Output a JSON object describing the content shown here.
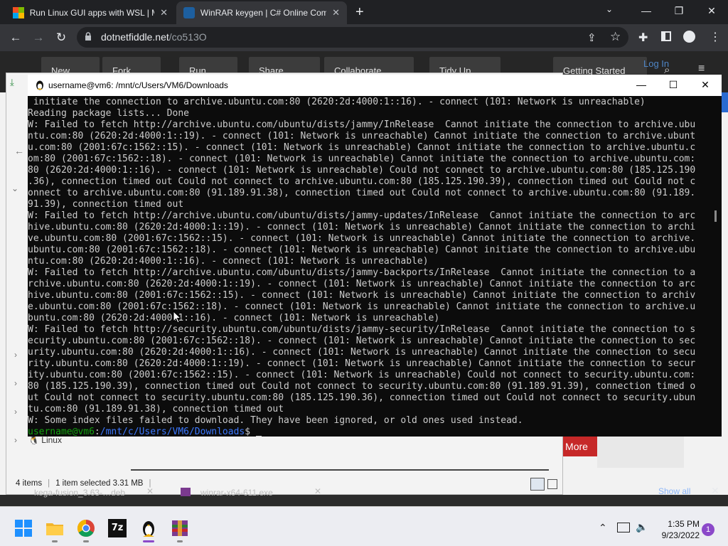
{
  "browser": {
    "tabs": [
      {
        "title": "Run Linux GUI apps with WSL | M",
        "active": false
      },
      {
        "title": "WinRAR keygen | C# Online Com",
        "active": true
      }
    ],
    "new_tab": "+",
    "window_controls": {
      "minimize": "—",
      "restore": "❐",
      "close": "✕"
    },
    "url_host": "dotnetfiddle.net",
    "url_path": "/co513O"
  },
  "site_toolbar": {
    "buttons": [
      "New",
      "Fork",
      "Run",
      "Share",
      "Collaborate",
      "Tidy Up",
      "Getting Started",
      "Log In"
    ]
  },
  "page": {
    "more_button": "More"
  },
  "explorer": {
    "sidebar_item": "Linux",
    "status_items": "4 items",
    "status_selected": "1 item selected  3.31 MB"
  },
  "downloads": {
    "items": [
      "kega-fusion_3.63-…deb",
      "winrar-x64-611.exe"
    ],
    "show_all": "Show all"
  },
  "terminal": {
    "title": "username@vm6: /mnt/c/Users/VM6/Downloads",
    "lines": [
      " initiate the connection to archive.ubuntu.com:80 (2620:2d:4000:1::16). - connect (101: Network is unreachable)",
      "Reading package lists... Done",
      "W: Failed to fetch http://archive.ubuntu.com/ubuntu/dists/jammy/InRelease  Cannot initiate the connection to archive.ubu",
      "ntu.com:80 (2620:2d:4000:1::19). - connect (101: Network is unreachable) Cannot initiate the connection to archive.ubunt",
      "u.com:80 (2001:67c:1562::15). - connect (101: Network is unreachable) Cannot initiate the connection to archive.ubuntu.c",
      "om:80 (2001:67c:1562::18). - connect (101: Network is unreachable) Cannot initiate the connection to archive.ubuntu.com:",
      "80 (2620:2d:4000:1::16). - connect (101: Network is unreachable) Could not connect to archive.ubuntu.com:80 (185.125.190",
      ".36), connection timed out Could not connect to archive.ubuntu.com:80 (185.125.190.39), connection timed out Could not c",
      "onnect to archive.ubuntu.com:80 (91.189.91.38), connection timed out Could not connect to archive.ubuntu.com:80 (91.189.",
      "91.39), connection timed out",
      "W: Failed to fetch http://archive.ubuntu.com/ubuntu/dists/jammy-updates/InRelease  Cannot initiate the connection to arc",
      "hive.ubuntu.com:80 (2620:2d:4000:1::19). - connect (101: Network is unreachable) Cannot initiate the connection to archi",
      "ve.ubuntu.com:80 (2001:67c:1562::15). - connect (101: Network is unreachable) Cannot initiate the connection to archive.",
      "ubuntu.com:80 (2001:67c:1562::18). - connect (101: Network is unreachable) Cannot initiate the connection to archive.ubu",
      "ntu.com:80 (2620:2d:4000:1::16). - connect (101: Network is unreachable)",
      "W: Failed to fetch http://archive.ubuntu.com/ubuntu/dists/jammy-backports/InRelease  Cannot initiate the connection to a",
      "rchive.ubuntu.com:80 (2620:2d:4000:1::19). - connect (101: Network is unreachable) Cannot initiate the connection to arc",
      "hive.ubuntu.com:80 (2001:67c:1562::15). - connect (101: Network is unreachable) Cannot initiate the connection to archiv",
      "e.ubuntu.com:80 (2001:67c:1562::18). - connect (101: Network is unreachable) Cannot initiate the connection to archive.u",
      "buntu.com:80 (2620:2d:4000:1::16). - connect (101: Network is unreachable)",
      "W: Failed to fetch http://security.ubuntu.com/ubuntu/dists/jammy-security/InRelease  Cannot initiate the connection to s",
      "ecurity.ubuntu.com:80 (2001:67c:1562::18). - connect (101: Network is unreachable) Cannot initiate the connection to sec",
      "urity.ubuntu.com:80 (2620:2d:4000:1::16). - connect (101: Network is unreachable) Cannot initiate the connection to secu",
      "rity.ubuntu.com:80 (2620:2d:4000:1::19). - connect (101: Network is unreachable) Cannot initiate the connection to secur",
      "ity.ubuntu.com:80 (2001:67c:1562::15). - connect (101: Network is unreachable) Could not connect to security.ubuntu.com:",
      "80 (185.125.190.39), connection timed out Could not connect to security.ubuntu.com:80 (91.189.91.39), connection timed o",
      "ut Could not connect to security.ubuntu.com:80 (185.125.190.36), connection timed out Could not connect to security.ubun",
      "tu.com:80 (91.189.91.38), connection timed out",
      "W: Some index files failed to download. They have been ignored, or old ones used instead."
    ],
    "prompt_user": "username@vm6",
    "prompt_sep": ":",
    "prompt_path": "/mnt/c/Users/VM6/Downloads",
    "prompt_end": "$ "
  },
  "taskbar": {
    "apps": [
      "start-icon",
      "file-explorer-icon",
      "chrome-icon",
      "7zip-icon",
      "linux-tux-icon",
      "winrar-icon"
    ],
    "time": "1:35 PM",
    "date": "9/23/2022",
    "notification_count": "1"
  },
  "colors": {
    "terminal_bg": "#0c0c0c",
    "prompt_green": "#13a10e",
    "prompt_blue": "#3b78ff",
    "more_red": "#c62828"
  }
}
